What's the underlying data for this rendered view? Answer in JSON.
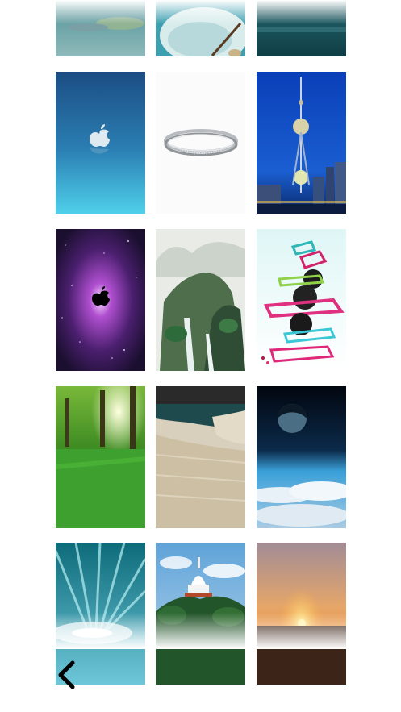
{
  "screen": "wallpaper-picker",
  "wallpapers": [
    "teal-landscape-top",
    "lace-and-blue-top",
    "dark-teal-top",
    "apple-logo-blue",
    "silver-ring",
    "oriental-pearl-tower-night",
    "apple-logo-purple-galaxy",
    "chinese-mountain-waterfall-painting",
    "abstract-colorful-frames",
    "green-forest-sunlight",
    "reeds-by-river",
    "planet-above-clouds",
    "feather-light-burst",
    "white-pagoda-on-hill",
    "orange-sunset"
  ],
  "nav": {
    "back_icon": "chevron-left-icon"
  },
  "colors": {
    "background": "#ffffff",
    "icon": "#000000"
  }
}
